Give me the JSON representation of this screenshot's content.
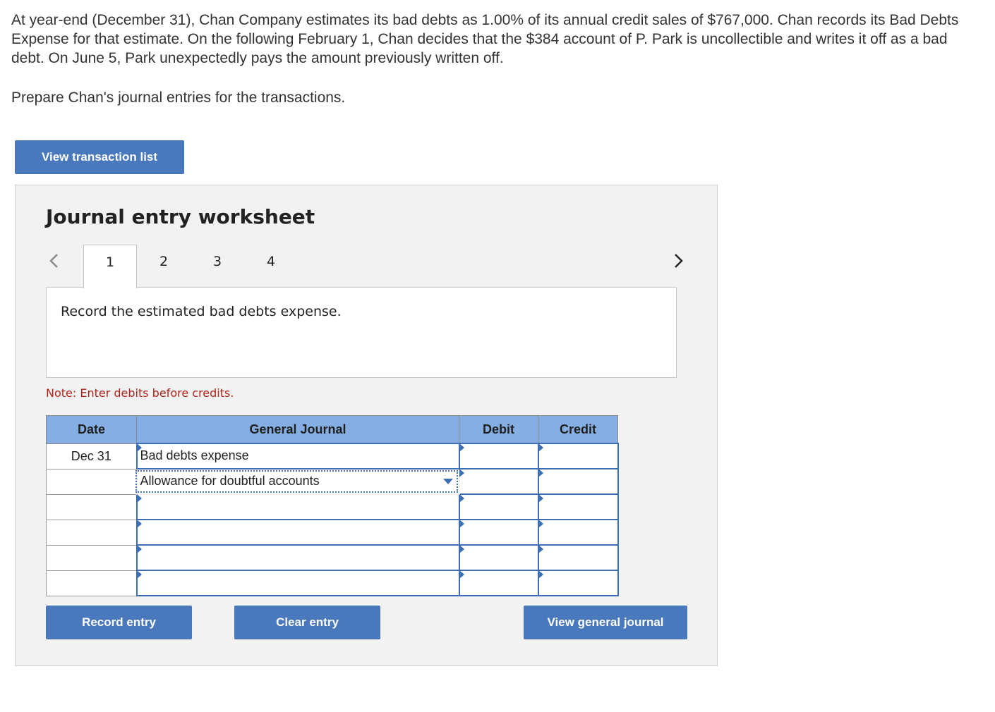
{
  "problem": {
    "text": "At year-end (December 31), Chan Company estimates its bad debts as 1.00% of its annual credit sales of $767,000. Chan records its Bad Debts Expense for that estimate. On the following February 1, Chan decides that the $384 account of P. Park is uncollectible and writes it off as a bad debt. On June 5, Park unexpectedly pays the amount previously written off.",
    "prompt": "Prepare Chan's journal entries for the transactions."
  },
  "buttons": {
    "view_transaction_list": "View transaction list",
    "record_entry": "Record entry",
    "clear_entry": "Clear entry",
    "view_general_journal": "View general journal"
  },
  "worksheet": {
    "title": "Journal entry worksheet",
    "tabs": [
      "1",
      "2",
      "3",
      "4"
    ],
    "active_tab": "1",
    "description": "Record the estimated bad debts expense.",
    "note": "Note: Enter debits before credits."
  },
  "journal": {
    "headers": {
      "date": "Date",
      "general_journal": "General Journal",
      "debit": "Debit",
      "credit": "Credit"
    },
    "rows": [
      {
        "date": "Dec 31",
        "account": "Bad debts expense",
        "debit": "",
        "credit": ""
      },
      {
        "date": "",
        "account": "Allowance for doubtful accounts",
        "debit": "",
        "credit": ""
      },
      {
        "date": "",
        "account": "",
        "debit": "",
        "credit": ""
      },
      {
        "date": "",
        "account": "",
        "debit": "",
        "credit": ""
      },
      {
        "date": "",
        "account": "",
        "debit": "",
        "credit": ""
      },
      {
        "date": "",
        "account": "",
        "debit": "",
        "credit": ""
      }
    ]
  },
  "colors": {
    "button": "#4a78bd",
    "header": "#85aee3",
    "note": "#b0231a",
    "input_border": "#3d6db5"
  },
  "icons": {
    "prev": "chevron-left-icon",
    "next": "chevron-right-icon",
    "dropdown": "dropdown-arrow-icon"
  }
}
